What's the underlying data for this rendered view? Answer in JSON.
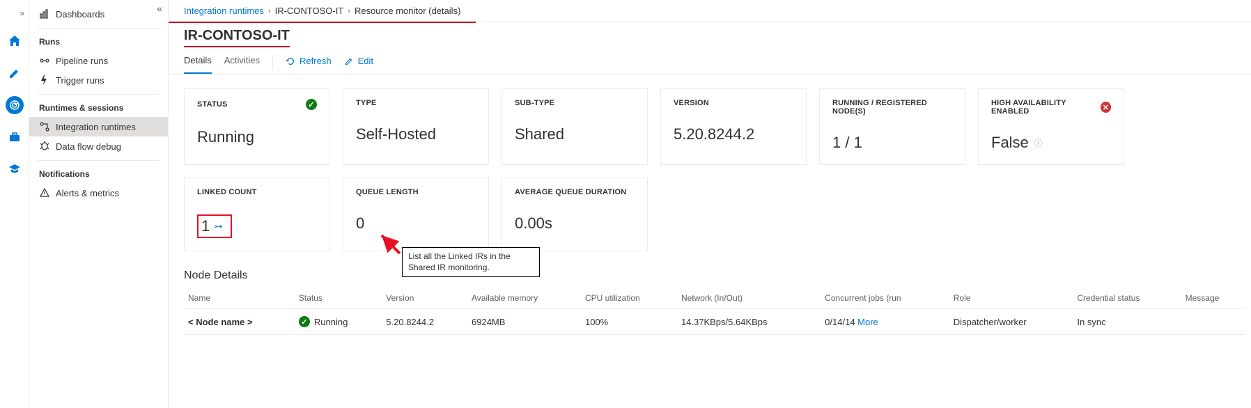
{
  "rail": {
    "spacer_icon": "spacer",
    "items": [
      "home-icon",
      "pencil-icon",
      "radar-icon",
      "toolbox-icon",
      "graduation-icon"
    ]
  },
  "sidebar": {
    "collapse_icon": "«",
    "dashboards_label": "Dashboards",
    "runs_label": "Runs",
    "pipeline_runs_label": "Pipeline runs",
    "trigger_runs_label": "Trigger runs",
    "runtimes_label": "Runtimes & sessions",
    "integration_runtimes_label": "Integration runtimes",
    "data_flow_debug_label": "Data flow debug",
    "notifications_label": "Notifications",
    "alerts_metrics_label": "Alerts & metrics"
  },
  "breadcrumb": {
    "a": "Integration runtimes",
    "b": "IR-CONTOSO-IT",
    "c": "Resource monitor (details)"
  },
  "title": "IR-CONTOSO-IT",
  "tabs": {
    "details": "Details",
    "activities": "Activities",
    "refresh": "Refresh",
    "edit": "Edit"
  },
  "cards": {
    "status_label": "STATUS",
    "status_value": "Running",
    "type_label": "TYPE",
    "type_value": "Self-Hosted",
    "subtype_label": "SUB-TYPE",
    "subtype_value": "Shared",
    "version_label": "VERSION",
    "version_value": "5.20.8244.2",
    "nodes_label": "RUNNING / REGISTERED NODE(S)",
    "nodes_value": "1 / 1",
    "ha_label": "HIGH AVAILABILITY ENABLED",
    "ha_value": "False",
    "linked_label": "LINKED COUNT",
    "linked_value": "1",
    "queue_label": "QUEUE LENGTH",
    "queue_value": "0",
    "avgq_label": "AVERAGE QUEUE DURATION",
    "avgq_value": "0.00s"
  },
  "annotation": "List all the Linked IRs in the Shared IR monitoring.",
  "node_details_title": "Node Details",
  "table": {
    "headers": [
      "Name",
      "Status",
      "Version",
      "Available memory",
      "CPU utilization",
      "Network (In/Out)",
      "Concurrent jobs (run",
      "Role",
      "Credential status",
      "Message"
    ],
    "row": {
      "name": "< Node name >",
      "status": "Running",
      "version": "5.20.8244.2",
      "memory": "6924MB",
      "cpu": "100%",
      "network": "14.37KBps/5.64KBps",
      "jobs": "0/14/14",
      "more": "More",
      "role": "Dispatcher/worker",
      "cred": "In sync",
      "msg": ""
    }
  }
}
